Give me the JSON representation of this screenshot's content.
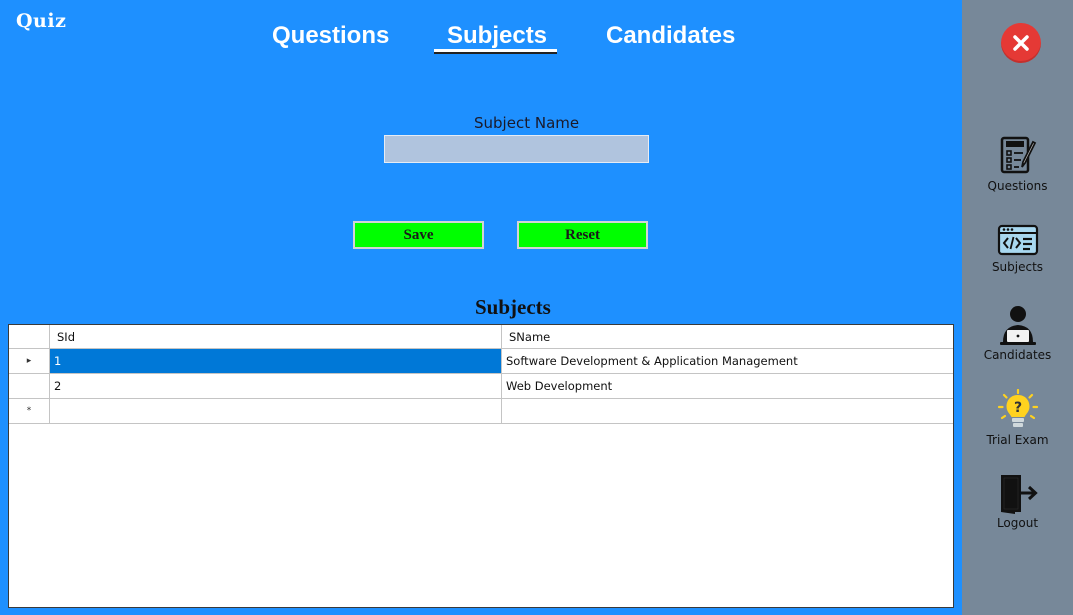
{
  "app": {
    "logo": "Quiz"
  },
  "tabs": [
    {
      "label": "Questions",
      "active": false
    },
    {
      "label": "Subjects",
      "active": true
    },
    {
      "label": "Candidates",
      "active": false
    }
  ],
  "form": {
    "subject_name_label": "Subject Name",
    "subject_name_value": "",
    "save_label": "Save",
    "reset_label": "Reset"
  },
  "grid": {
    "title": "Subjects",
    "columns": [
      "SId",
      "SName"
    ],
    "rows": [
      {
        "marker": "▸",
        "sid": "1",
        "sname": "Software Development & Application Management",
        "selected": true
      },
      {
        "marker": "",
        "sid": "2",
        "sname": "Web Development",
        "selected": false
      },
      {
        "marker": "*",
        "sid": "",
        "sname": "",
        "selected": false
      }
    ]
  },
  "sidebar": {
    "items": [
      {
        "label": "Questions",
        "icon": "test-paper-icon"
      },
      {
        "label": "Subjects",
        "icon": "code-window-icon"
      },
      {
        "label": "Candidates",
        "icon": "user-laptop-icon"
      },
      {
        "label": "Trial Exam",
        "icon": "lightbulb-question-icon"
      },
      {
        "label": "Logout",
        "icon": "logout-door-icon"
      }
    ]
  },
  "colors": {
    "main_background": "#1e90ff",
    "sidebar_background": "#778899",
    "button_background": "#00ff00",
    "input_background": "#b0c4de",
    "selection": "#0078d7",
    "close_button": "#e53935"
  }
}
